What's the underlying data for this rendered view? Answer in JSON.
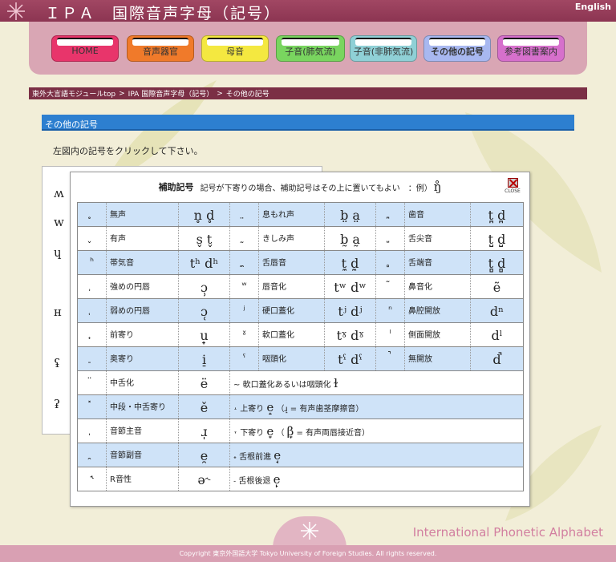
{
  "header": {
    "title": "ＩＰＡ　国際音声字母（記号）",
    "english_link": "English"
  },
  "nav": [
    {
      "label": "HOME",
      "color": "#e8356b"
    },
    {
      "label": "音声器官",
      "color": "#f07a2a"
    },
    {
      "label": "母音",
      "color": "#f4e840"
    },
    {
      "label": "子音(肺気流)",
      "color": "#79d55f"
    },
    {
      "label": "子音(非肺気流)",
      "color": "#8fd0d6"
    },
    {
      "label": "その他の記号",
      "color": "#a8b8f0"
    },
    {
      "label": "参考図書案内",
      "color": "#d670cc"
    }
  ],
  "breadcrumb": {
    "items": [
      "東外大言語モジュールtop",
      "IPA 国際音声字母（記号）",
      "その他の記号"
    ],
    "separator": ">"
  },
  "section": {
    "title": "その他の記号",
    "instruction": "左図内の記号をクリックして下さい。"
  },
  "side_symbols": [
    "ʍ",
    "w",
    "ɥ",
    "ʜ",
    "ʢ",
    "ʡ"
  ],
  "popup": {
    "title": "補助記号",
    "note": "記号が下寄りの場合、補助記号はその上に置いてもよい　：例）",
    "example": "ŋ̊",
    "close_label": "CLOSE",
    "rows": [
      {
        "type": "triple",
        "cells": [
          {
            "mark": "̥",
            "name": "無声",
            "ex": "n̥ d̥"
          },
          {
            "mark": "̤",
            "name": "息もれ声",
            "ex": "b̤ a̤"
          },
          {
            "mark": "̪",
            "name": "歯音",
            "ex": "t̪ d̪"
          }
        ]
      },
      {
        "type": "triple",
        "cells": [
          {
            "mark": "̬",
            "name": "有声",
            "ex": "s̬ t̬"
          },
          {
            "mark": "̰",
            "name": "きしみ声",
            "ex": "b̰ a̰"
          },
          {
            "mark": "̺",
            "name": "舌尖音",
            "ex": "t̺ d̺"
          }
        ]
      },
      {
        "type": "triple",
        "cells": [
          {
            "mark": "ʰ",
            "name": "帯気音",
            "ex": "tʰ dʰ"
          },
          {
            "mark": "̼",
            "name": "舌唇音",
            "ex": "t̼ d̼"
          },
          {
            "mark": "̻",
            "name": "舌端音",
            "ex": "t̻ d̻"
          }
        ]
      },
      {
        "type": "triple",
        "cells": [
          {
            "mark": "̹",
            "name": "強めの円唇",
            "ex": "ɔ̹"
          },
          {
            "mark": "ʷ",
            "name": "唇音化",
            "ex": "tʷ dʷ"
          },
          {
            "mark": "̃",
            "name": "鼻音化",
            "ex": "ẽ"
          }
        ]
      },
      {
        "type": "triple",
        "cells": [
          {
            "mark": "̜",
            "name": "弱めの円唇",
            "ex": "ɔ̜"
          },
          {
            "mark": "ʲ",
            "name": "硬口蓋化",
            "ex": "tʲ dʲ"
          },
          {
            "mark": "ⁿ",
            "name": "鼻腔開放",
            "ex": "dⁿ"
          }
        ]
      },
      {
        "type": "triple",
        "cells": [
          {
            "mark": "̟",
            "name": "前寄り",
            "ex": "u̟"
          },
          {
            "mark": "ˠ",
            "name": "軟口蓋化",
            "ex": "tˠ dˠ"
          },
          {
            "mark": "ˡ",
            "name": "側面開放",
            "ex": "dˡ"
          }
        ]
      },
      {
        "type": "triple",
        "cells": [
          {
            "mark": "̠",
            "name": "奥寄り",
            "ex": "i̠"
          },
          {
            "mark": "ˤ",
            "name": "咽頭化",
            "ex": "tˤ dˤ"
          },
          {
            "mark": "̚",
            "name": "無開放",
            "ex": "d̚"
          }
        ]
      },
      {
        "type": "wide",
        "mark": "̈",
        "name": "中舌化",
        "ex": "ë",
        "desc_mark": "~",
        "desc": "軟口蓋化あるいは咽頭化",
        "desc_ex": "ɫ"
      },
      {
        "type": "wide",
        "mark": "̽",
        "name": "中段・中舌寄り",
        "ex": "ě",
        "desc_mark": "˔",
        "desc": "上寄り",
        "desc_ex": "e̝",
        "desc_note": "（ɹ̝ = 有声歯茎摩擦音）"
      },
      {
        "type": "wide",
        "mark": "̩",
        "name": "音節主音",
        "ex": "ɹ̩",
        "desc_mark": "˕",
        "desc": "下寄り",
        "desc_ex": "e̞",
        "desc_note_pre": "（",
        "desc_note_ipa": "β̞",
        "desc_note_post": " = 有声両唇接近音）"
      },
      {
        "type": "wide",
        "mark": "̯",
        "name": "音節副音",
        "ex": "e̯",
        "desc_mark": "˖",
        "desc": "舌根前進",
        "desc_ex": "e̘"
      },
      {
        "type": "wide",
        "mark": "˞",
        "name": "R音性",
        "ex": "ə˞",
        "desc_mark": "˗",
        "desc": "舌根後退",
        "desc_ex": "e̙"
      }
    ]
  },
  "footer": {
    "brand": "International Phonetic Alphabet",
    "copyright": "Copyright 東京外国語大学 Tokyo University of Foreign Studies. All rights reserved."
  }
}
